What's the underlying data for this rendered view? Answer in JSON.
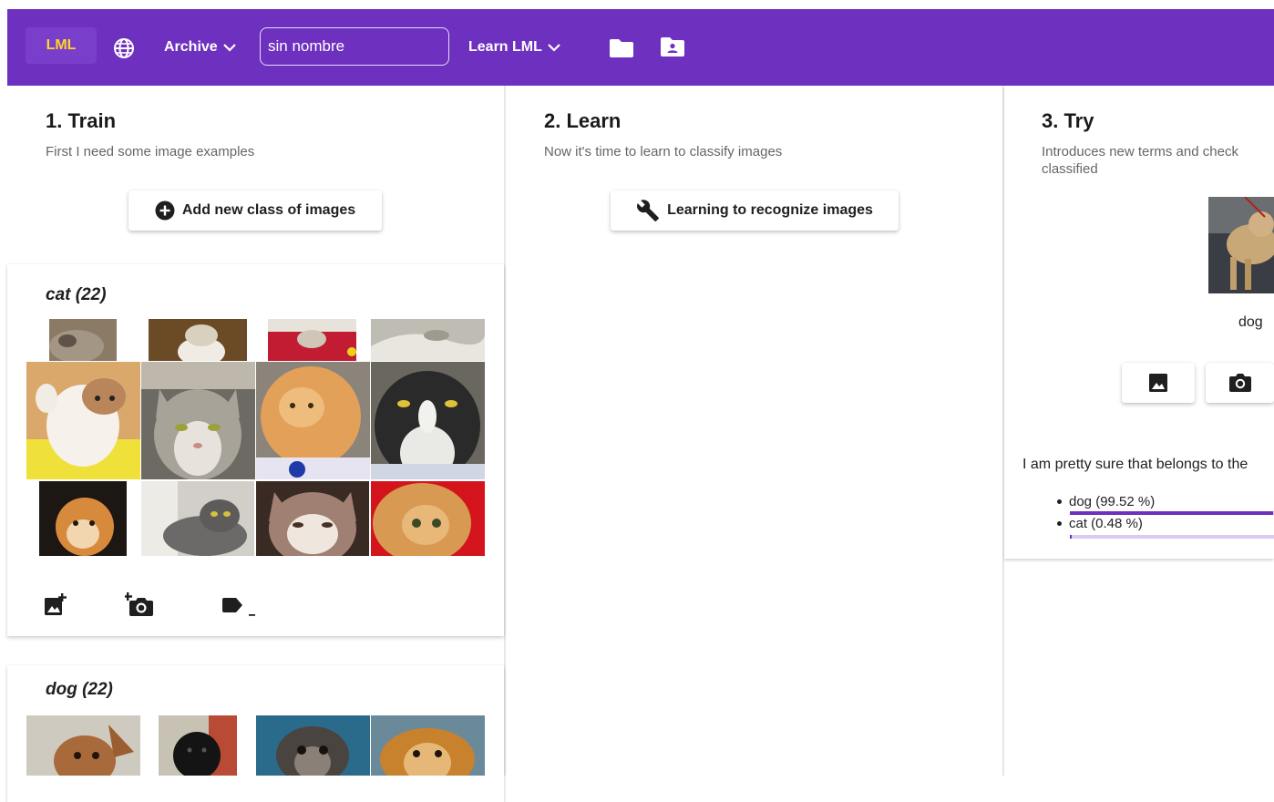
{
  "app": {
    "logo": "LML",
    "menu_archive": "Archive",
    "project_name": "sin nombre",
    "menu_learn": "Learn LML"
  },
  "train": {
    "title": "1. Train",
    "subtitle": "First I need some image examples",
    "add_class_label": "Add new class of images",
    "classes": [
      {
        "label": "cat (22)"
      },
      {
        "label": "dog (22)"
      }
    ]
  },
  "learn": {
    "title": "2. Learn",
    "subtitle": "Now it's time to learn to classify images",
    "button_label": "Learning to recognize images"
  },
  "try": {
    "title": "3. Try",
    "subtitle": "Introduces new terms and check classified",
    "predicted_label": "dog",
    "result_text": "I am pretty sure that belongs to the",
    "results": [
      {
        "label": "dog (99.52 %)",
        "percent": 99.52
      },
      {
        "label": "cat (0.48 %)",
        "percent": 0.48
      }
    ]
  },
  "colors": {
    "accent": "#6e30bf",
    "logo_text": "#ffd42a"
  }
}
